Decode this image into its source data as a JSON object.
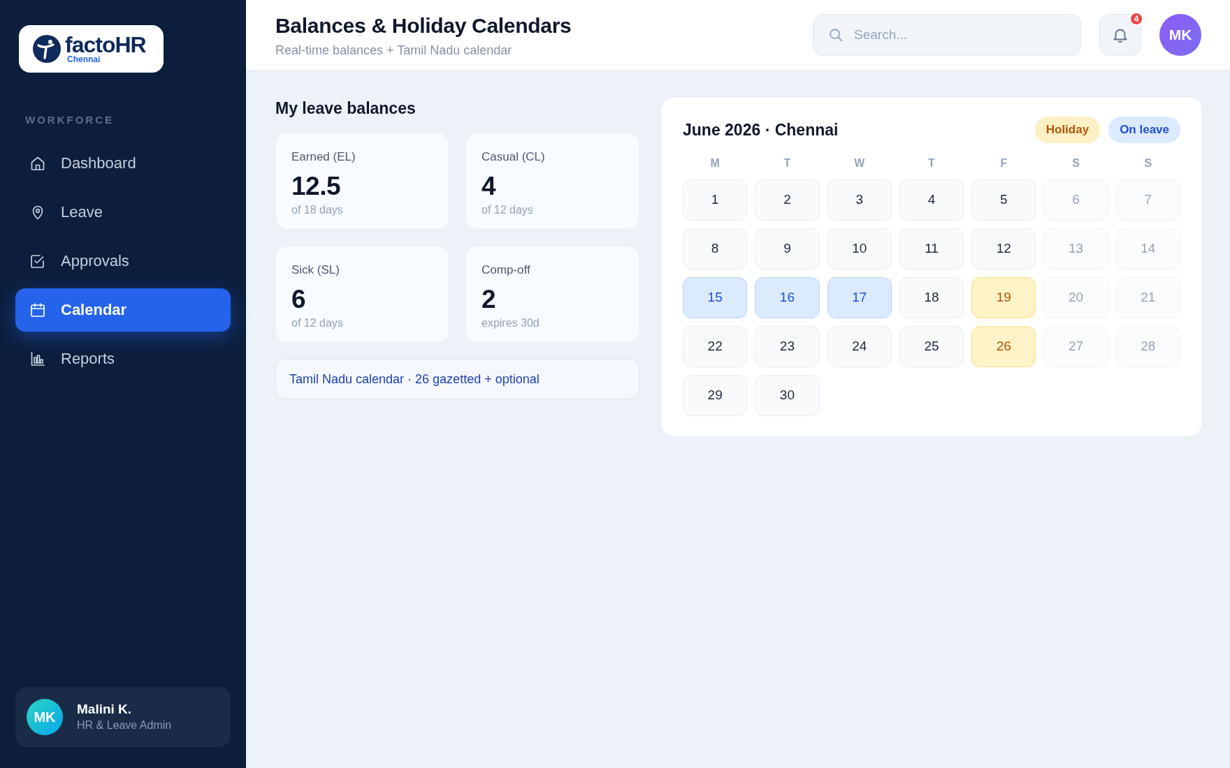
{
  "sidebar": {
    "logo": {
      "wordmark": "factoHR",
      "location": "Chennai"
    },
    "section_label": "WORKFORCE",
    "items": [
      {
        "label": "Dashboard",
        "selected": false
      },
      {
        "label": "Leave",
        "selected": false
      },
      {
        "label": "Approvals",
        "selected": false
      },
      {
        "label": "Calendar",
        "selected": true
      },
      {
        "label": "Reports",
        "selected": false
      }
    ],
    "user": {
      "initials": "MK",
      "name": "Malini K.",
      "role": "HR & Leave Admin"
    }
  },
  "header": {
    "title": "Balances & Holiday Calendars",
    "subtitle": "Real-time balances + Tamil Nadu calendar",
    "search": {
      "placeholder": "Search..."
    },
    "notifications": {
      "count": "4"
    },
    "avatar": {
      "initials": "MK"
    }
  },
  "balances": {
    "title": "My leave balances",
    "cards": [
      {
        "label": "Earned (EL)",
        "value": "12.5",
        "detail": "of 18 days"
      },
      {
        "label": "Casual (CL)",
        "value": "4",
        "detail": "of 12 days"
      },
      {
        "label": "Sick (SL)",
        "value": "6",
        "detail": "of 12 days"
      },
      {
        "label": "Comp-off",
        "value": "2",
        "detail": "expires 30d"
      }
    ],
    "note": "Tamil Nadu calendar · 26 gazetted + optional"
  },
  "calendar": {
    "title": "June 2026 · Chennai",
    "legend": [
      {
        "label": "Holiday",
        "kind": "holiday"
      },
      {
        "label": "On leave",
        "kind": "leave"
      }
    ],
    "weekdays": [
      "M",
      "T",
      "W",
      "T",
      "F",
      "S",
      "S"
    ],
    "days": [
      {
        "label": "1",
        "kind": "workday"
      },
      {
        "label": "2",
        "kind": "workday"
      },
      {
        "label": "3",
        "kind": "workday"
      },
      {
        "label": "4",
        "kind": "workday"
      },
      {
        "label": "5",
        "kind": "workday"
      },
      {
        "label": "6",
        "kind": "weekend"
      },
      {
        "label": "7",
        "kind": "weekend"
      },
      {
        "label": "8",
        "kind": "workday"
      },
      {
        "label": "9",
        "kind": "workday"
      },
      {
        "label": "10",
        "kind": "workday"
      },
      {
        "label": "11",
        "kind": "workday"
      },
      {
        "label": "12",
        "kind": "workday"
      },
      {
        "label": "13",
        "kind": "weekend"
      },
      {
        "label": "14",
        "kind": "weekend"
      },
      {
        "label": "15",
        "kind": "leave"
      },
      {
        "label": "16",
        "kind": "leave"
      },
      {
        "label": "17",
        "kind": "leave"
      },
      {
        "label": "18",
        "kind": "workday"
      },
      {
        "label": "19",
        "kind": "holiday"
      },
      {
        "label": "20",
        "kind": "weekend"
      },
      {
        "label": "21",
        "kind": "weekend"
      },
      {
        "label": "22",
        "kind": "workday"
      },
      {
        "label": "23",
        "kind": "workday"
      },
      {
        "label": "24",
        "kind": "workday"
      },
      {
        "label": "25",
        "kind": "workday"
      },
      {
        "label": "26",
        "kind": "holiday"
      },
      {
        "label": "27",
        "kind": "weekend"
      },
      {
        "label": "28",
        "kind": "weekend"
      },
      {
        "label": "29",
        "kind": "workday"
      },
      {
        "label": "30",
        "kind": "workday"
      }
    ]
  }
}
